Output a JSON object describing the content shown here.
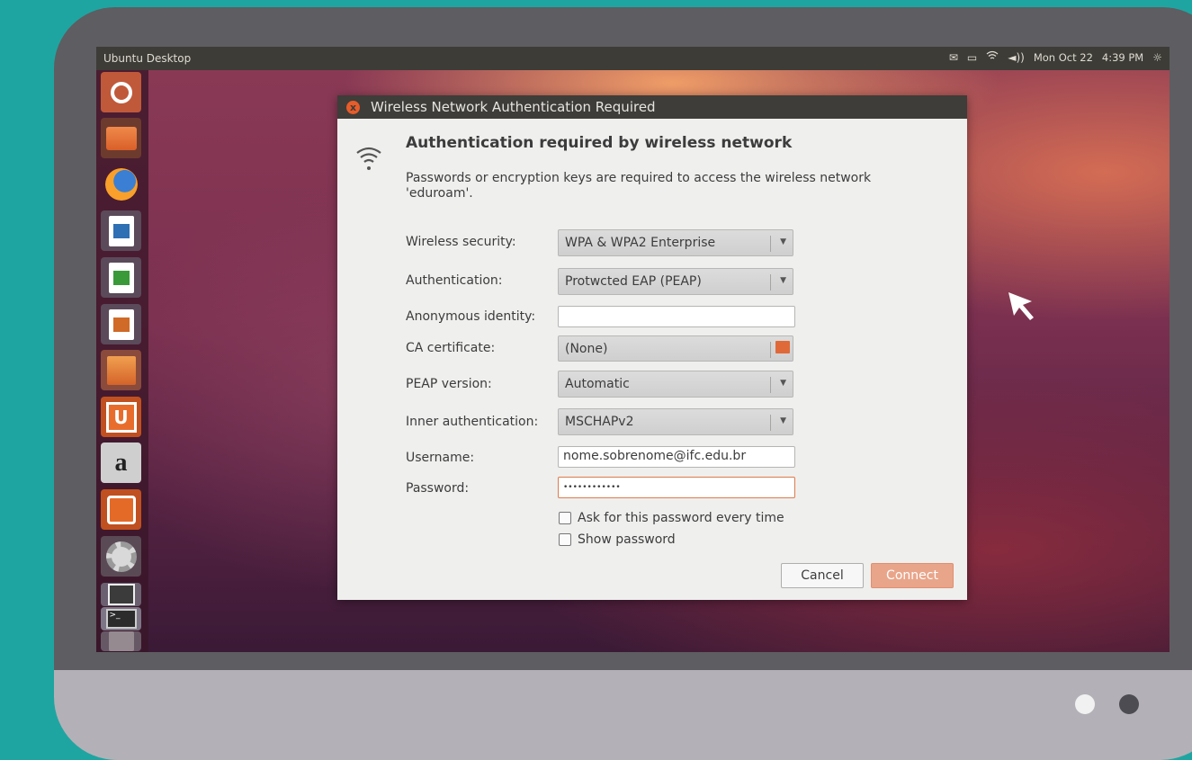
{
  "topbar": {
    "title": "Ubuntu Desktop",
    "date": "Mon Oct 22",
    "time": "4:39 PM",
    "icons": [
      "mail-icon",
      "battery-icon",
      "wifi-icon",
      "volume-icon",
      "gear-icon"
    ]
  },
  "launcher": {
    "items": [
      "dash-home",
      "files",
      "firefox",
      "libreoffice-writer",
      "libreoffice-calc",
      "libreoffice-impress",
      "software-center",
      "ubuntu-one",
      "amazon",
      "ubuntu-one-music",
      "system-settings",
      "workspace-switcher",
      "terminal",
      "trash"
    ]
  },
  "dialog": {
    "title": "Wireless Network Authentication Required",
    "heading": "Authentication required by wireless network",
    "description": "Passwords or encryption keys are required to access the wireless network 'eduroam'.",
    "fields": {
      "wireless_security_label": "Wireless security:",
      "wireless_security_value": "WPA & WPA2 Enterprise",
      "authentication_label": "Authentication:",
      "authentication_value": "Protwcted EAP (PEAP)",
      "anonymous_identity_label": "Anonymous identity:",
      "anonymous_identity_value": "",
      "ca_certificate_label": "CA certificate:",
      "ca_certificate_value": "(None)",
      "peap_version_label": "PEAP version:",
      "peap_version_value": "Automatic",
      "inner_auth_label": "Inner authentication:",
      "inner_auth_value": "MSCHAPv2",
      "username_label": "Username:",
      "username_value": "nome.sobrenome@ifc.edu.br",
      "password_label": "Password:",
      "password_value": "••••••••••••"
    },
    "checkboxes": {
      "ask_password": "Ask for this password every time",
      "show_password": "Show password"
    },
    "buttons": {
      "cancel": "Cancel",
      "connect": "Connect"
    }
  },
  "colors": {
    "accent": "#e75c2a",
    "connect_button": "#e9a58a",
    "background": "#1fa5a1"
  }
}
